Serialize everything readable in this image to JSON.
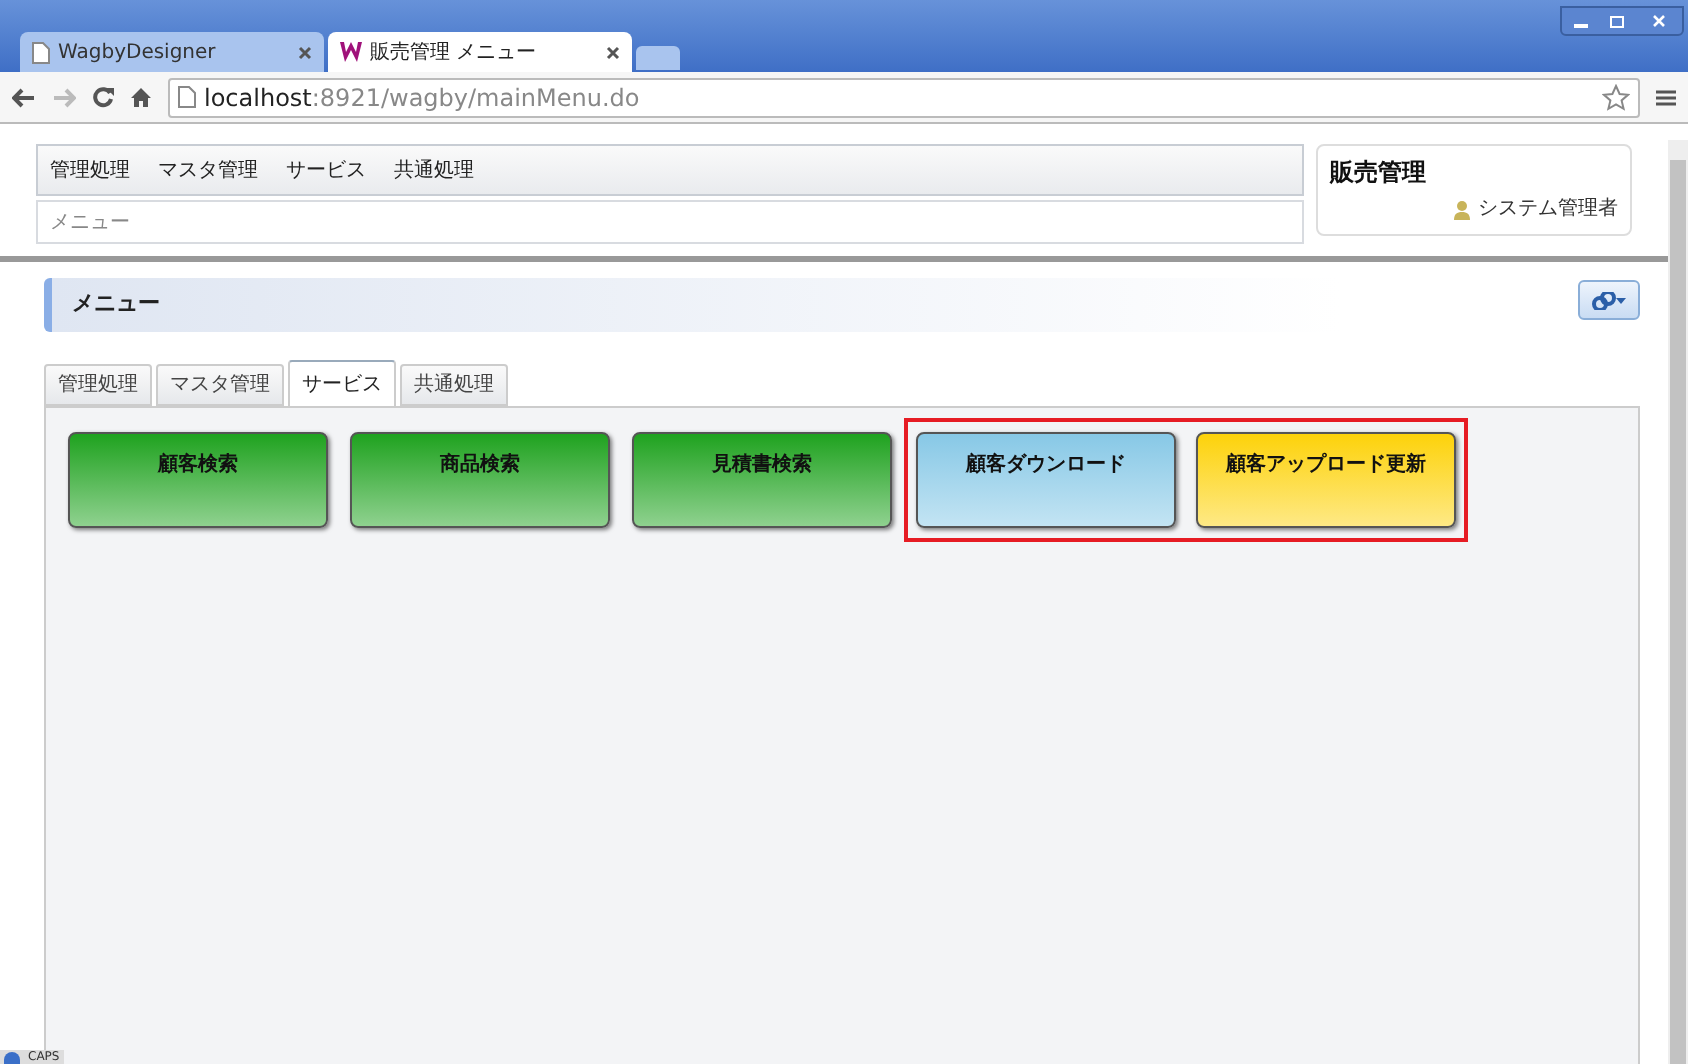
{
  "browser": {
    "tabs": [
      {
        "title": "WagbyDesigner",
        "selected": false,
        "kind": "page"
      },
      {
        "title": "販売管理 メニュー",
        "selected": true,
        "kind": "logo"
      }
    ],
    "url_host": "localhost",
    "url_rest": ":8921/wagby/mainMenu.do"
  },
  "header": {
    "menu": [
      "管理処理",
      "マスタ管理",
      "サービス",
      "共通処理"
    ],
    "breadcrumb": "メニュー",
    "app_title": "販売管理",
    "user": "システム管理者"
  },
  "panel": {
    "title": "メニュー",
    "tabs": [
      {
        "label": "管理処理",
        "selected": false
      },
      {
        "label": "マスタ管理",
        "selected": false
      },
      {
        "label": "サービス",
        "selected": true
      },
      {
        "label": "共通処理",
        "selected": false
      }
    ],
    "buttons": [
      {
        "label": "顧客検索",
        "color": "#1fa21f"
      },
      {
        "label": "商品検索",
        "color": "#1fa21f"
      },
      {
        "label": "見積書検索",
        "color": "#1fa21f"
      }
    ],
    "highlight_frame": {
      "buttons": [
        {
          "label": "顧客ダウンロード",
          "color": "#87c8e6"
        },
        {
          "label": "顧客アップロード更新",
          "color": "#fdd20a"
        }
      ]
    }
  },
  "status_bar": {
    "caps": "CAPS"
  }
}
